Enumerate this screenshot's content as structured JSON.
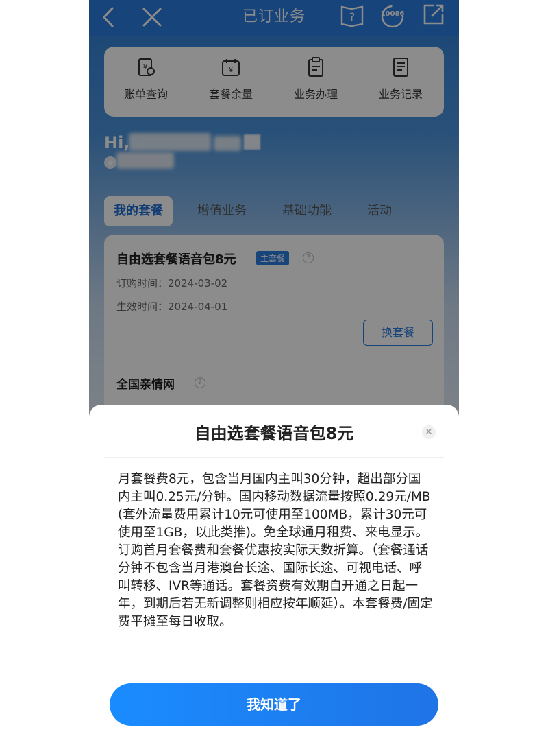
{
  "topbar": {
    "title": "已订业务",
    "hotline_badge": "10086"
  },
  "quick_actions": [
    {
      "label": "账单查询",
      "icon": "bill-icon"
    },
    {
      "label": "套餐余量",
      "icon": "calendar-yen-icon"
    },
    {
      "label": "业务办理",
      "icon": "clipboard-icon"
    },
    {
      "label": "业务记录",
      "icon": "document-icon"
    }
  ],
  "greeting": {
    "prefix": "Hi, 1"
  },
  "tabs": [
    {
      "label": "我的套餐",
      "active": true
    },
    {
      "label": "增值业务",
      "active": false
    },
    {
      "label": "基础功能",
      "active": false
    },
    {
      "label": "活动",
      "active": false
    }
  ],
  "plan_card": {
    "title": "自由选套餐语音包8元",
    "badge": "主套餐",
    "purchase_label": "订购时间：",
    "purchase_date": "2024-03-02",
    "effective_label": "生效时间：",
    "effective_date": "2024-04-01",
    "switch_button": "换套餐",
    "second_title": "全国亲情网"
  },
  "sheet": {
    "title": "自由选套餐语音包8元",
    "body": "月套餐费8元，包含当月国内主叫30分钟，超出部分国内主叫0.25元/分钟。国内移动数据流量按照0.29元/MB(套外流量费用累计10元可使用至100MB，累计30元可使用至1GB，以此类推)。免全球通月租费、来电显示。订购首月套餐费和套餐优惠按实际天数折算。（套餐通话分钟不包含当月港澳台长途、国际长途、可视电话、呼叫转移、IVR等通话。套餐资费有效期自开通之日起一年，到期后若无新调整则相应按年顺延）。本套餐费/固定费平摊至每日收取。",
    "ok_button": "我知道了"
  },
  "colors": {
    "primary": "#2b7ce0",
    "button_gradient_start": "#1a8cff",
    "button_gradient_end": "#1f74e6"
  }
}
